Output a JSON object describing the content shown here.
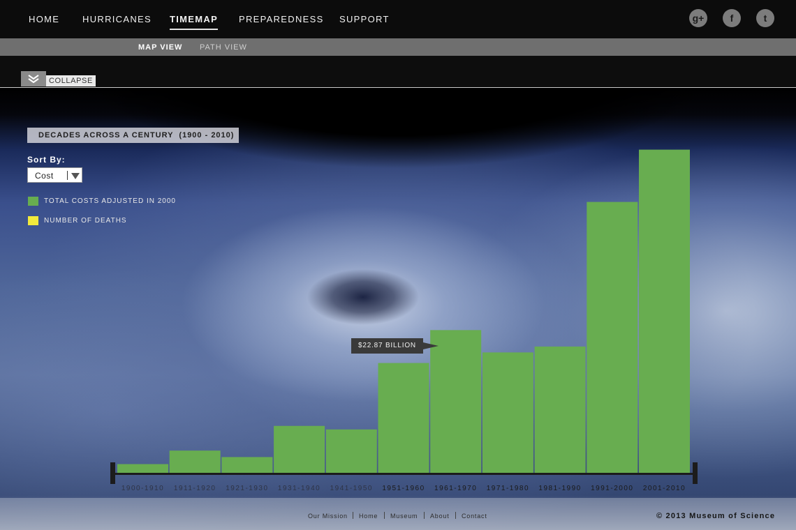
{
  "nav": {
    "items": [
      "HOME",
      "HURRICANES",
      "TIMEMAP",
      "PREPAREDNESS",
      "SUPPORT"
    ],
    "active": "TIMEMAP",
    "social": [
      {
        "name": "google-plus-icon",
        "glyph": "g+"
      },
      {
        "name": "facebook-icon",
        "glyph": "f"
      },
      {
        "name": "twitter-icon",
        "glyph": "t"
      }
    ]
  },
  "subnav": {
    "items": [
      "MAP VIEW",
      "PATH VIEW"
    ],
    "active": "MAP VIEW"
  },
  "collapse": {
    "label": "COLLAPSE"
  },
  "panel": {
    "title": "DECADES ACROSS A CENTURY  (1900 - 2010)",
    "sort_label": "Sort By:",
    "sort_value": "Cost",
    "legend": [
      {
        "label": "TOTAL COSTS ADJUSTED IN 2000",
        "color": "#68ad50"
      },
      {
        "label": "NUMBER OF DEATHS",
        "color": "#f2ea3c"
      }
    ]
  },
  "chart_data": {
    "type": "bar",
    "categories": [
      "1900-1910",
      "1911-1920",
      "1921-1930",
      "1931-1940",
      "1941-1950",
      "1951-1960",
      "1961-1970",
      "1971-1980",
      "1981-1990",
      "1991-2000",
      "2001-2010"
    ],
    "values": [
      1.6,
      3.9,
      2.8,
      8.1,
      7.5,
      18.8,
      24.4,
      20.6,
      21.6,
      46.2,
      55.1
    ],
    "ylim": [
      0,
      56
    ],
    "unit": "billion",
    "bar_color": "#68ad50",
    "axis_color": "#1c1c1c",
    "tooltip": {
      "category": "1961-1970",
      "text": "$22.87 BILLION"
    }
  },
  "footer": {
    "links": [
      "Our Mission",
      "Home",
      "Museum",
      "About",
      "Contact"
    ],
    "copyright": "©  2013 Museum of Science"
  }
}
